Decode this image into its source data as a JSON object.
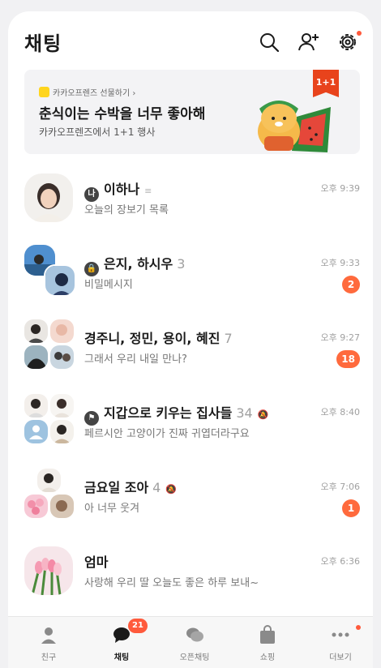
{
  "header": {
    "title": "채팅",
    "icons": [
      "search-icon",
      "add-friend-icon",
      "settings-icon"
    ]
  },
  "banner": {
    "brand": "카카오프렌즈 선물하기 ›",
    "title": "춘식이는 수박을 너무 좋아해",
    "subtitle": "카카오프렌즈에서 1+1 행사",
    "tag": "1+1"
  },
  "chats": [
    {
      "name": "이하나",
      "prefix": "나",
      "suffix": "≡",
      "count": "",
      "message": "오늘의 장보기 목록",
      "time": "오후 9:39",
      "badge": ""
    },
    {
      "name": "은지, 하시우",
      "prefix": "🔒",
      "count": "3",
      "message": "비밀메시지",
      "time": "오후 9:33",
      "badge": "2"
    },
    {
      "name": "경주니, 정민, 용이, 혜진",
      "count": "7",
      "message": "그래서 우리 내일 만나?",
      "time": "오후 9:27",
      "badge": "18"
    },
    {
      "name": "지갑으로 키우는 집사들",
      "prefix": "⚑",
      "count": "34",
      "muted": "🔕",
      "message": "페르시안 고양이가 진짜 귀엽더라구요",
      "time": "오후 8:40",
      "badge": ""
    },
    {
      "name": "금요일 조아",
      "count": "4",
      "muted": "🔕",
      "message": "아 너무 웃겨",
      "time": "오후 7:06",
      "badge": "1"
    },
    {
      "name": "엄마",
      "count": "",
      "message": "사랑해 우리 딸 오늘도 좋은 하루 보내~",
      "time": "오후 6:36",
      "badge": ""
    }
  ],
  "tabs": [
    {
      "label": "친구",
      "icon": "person-icon"
    },
    {
      "label": "채팅",
      "icon": "chat-bubble-icon",
      "badge": "21"
    },
    {
      "label": "오픈채팅",
      "icon": "open-chat-icon"
    },
    {
      "label": "쇼핑",
      "icon": "shopping-bag-icon"
    },
    {
      "label": "더보기",
      "icon": "more-icon"
    }
  ],
  "colors": {
    "accent": "#ff6a3d",
    "badge": "#ff5a3c",
    "brand_yellow": "#ffd51e"
  }
}
